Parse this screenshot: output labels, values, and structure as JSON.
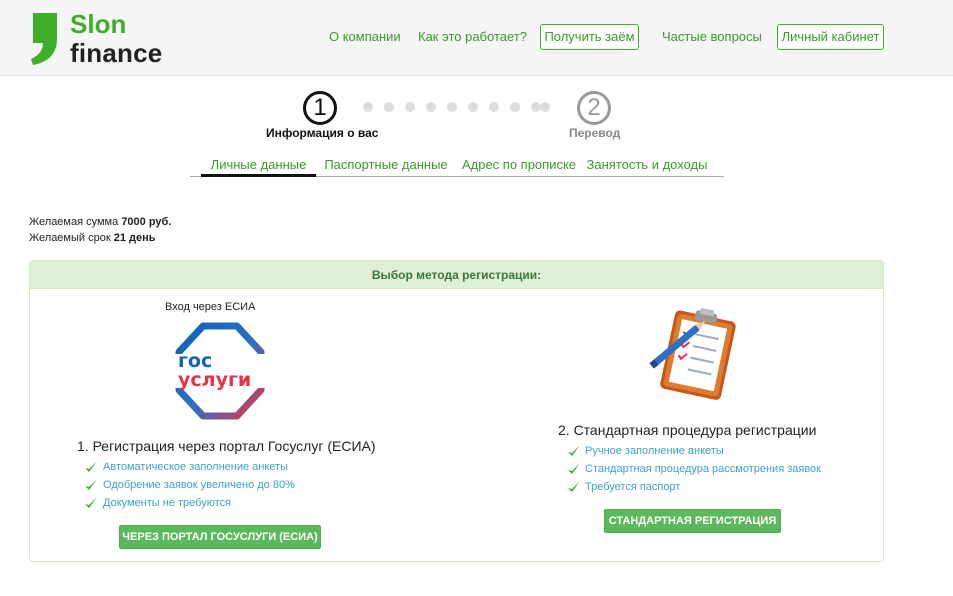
{
  "brand": {
    "line1": "Slon",
    "line2": "finance"
  },
  "nav": {
    "about": "О компании",
    "how": "Как это работает?",
    "get_loan": "Получить заём",
    "faq": "Частые вопросы",
    "cabinet": "Личный кабинет"
  },
  "steps": [
    {
      "number": "1",
      "label": "Информация о вас"
    },
    {
      "number": "2",
      "label": "Перевод"
    }
  ],
  "tabs": [
    "Личные данные",
    "Паспортные данные",
    "Адрес по прописке",
    "Занятость и доходы"
  ],
  "summary": {
    "amount_label": "Желаемая сумма",
    "amount_value": "7000 руб.",
    "term_label": "Желаемый срок",
    "term_value": "21 день"
  },
  "panel": {
    "title": "Выбор метода регистрации:",
    "esia_caption": "Вход через ЕСИА",
    "gos_logo": {
      "line1": "гос",
      "line2": "услуги"
    },
    "method1": {
      "title": "1. Регистрация через портал Госуслуг (ЕСИА)",
      "features": [
        "Автоматическое заполнение анкеты",
        "Одобрение заявок увеличено до 80%",
        "Документы не требуются"
      ],
      "button": "ЧЕРЕЗ ПОРТАЛ ГОСУСЛУГИ (ЕСИА)"
    },
    "method2": {
      "title": "2. Стандартная процедура регистрации",
      "features": [
        "Ручное заполнение анкеты",
        "Стандартная процедура рассмотрения заявок",
        "Требуется паспорт"
      ],
      "button": "СТАНДАРТНАЯ РЕГИСТРАЦИЯ"
    }
  },
  "colors": {
    "brand_green": "#3fae29",
    "button_green": "#5cb85c",
    "feature_blue": "#3ea0c8",
    "panel_head_bg": "#dff0d8"
  },
  "icons": [
    "brand-comma-icon",
    "gosuslugi-logo",
    "clipboard-icon",
    "checkmark-icon"
  ]
}
